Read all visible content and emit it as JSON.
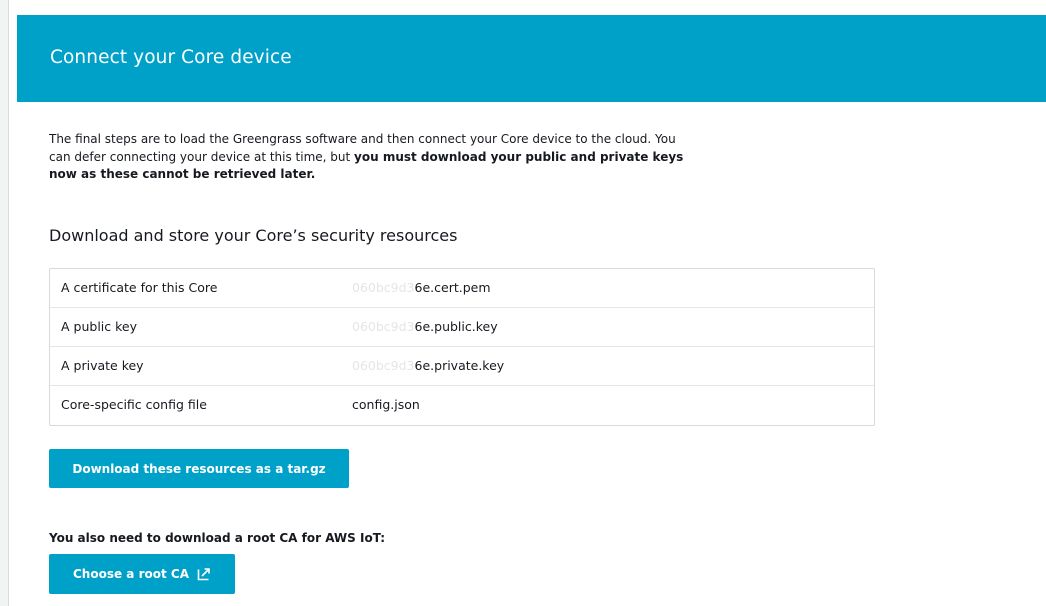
{
  "header": {
    "title": "Connect your Core device"
  },
  "intro": {
    "text_plain": "The final steps are to load the Greengrass software and then connect your Core device to the cloud. You can defer connecting your device at this time, but ",
    "text_bold": "you must download your public and private keys now as these cannot be retrieved later."
  },
  "security": {
    "title": "Download and store your Core’s security resources",
    "rows": [
      {
        "label": "A certificate for this Core",
        "file_prefix": "060bc9d3",
        "file_suffix": "6e.cert.pem"
      },
      {
        "label": "A public key",
        "file_prefix": "060bc9d3",
        "file_suffix": "6e.public.key"
      },
      {
        "label": "A private key",
        "file_prefix": "060bc9d3",
        "file_suffix": "6e.private.key"
      },
      {
        "label": "Core-specific config file",
        "file_prefix": "",
        "file_suffix": "config.json"
      }
    ]
  },
  "download_button": {
    "label": "Download these resources as a tar.gz"
  },
  "root_ca": {
    "note": "You also need to download a root CA for AWS IoT:",
    "button_label": "Choose a root CA",
    "button_icon": "external-link-icon"
  },
  "colors": {
    "header_bg": "#00a1c9",
    "button_bg": "#00a1c9"
  }
}
